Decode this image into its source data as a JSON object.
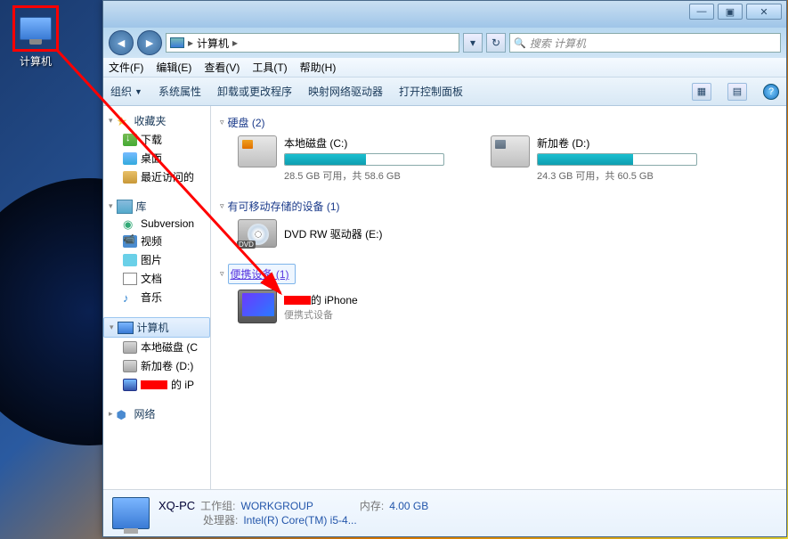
{
  "desktop": {
    "icon_label": "计算机"
  },
  "window": {
    "sys": {
      "min": "—",
      "max": "▣",
      "close": "✕"
    },
    "address": {
      "crumb1": "计算机",
      "refresh": "↻",
      "dropdown": "▾",
      "search_placeholder": "搜索 计算机"
    },
    "menu": {
      "file": "文件(F)",
      "edit": "编辑(E)",
      "view": "查看(V)",
      "tools": "工具(T)",
      "help": "帮助(H)"
    },
    "toolbar": {
      "organize": "组织",
      "properties": "系统属性",
      "uninstall": "卸载或更改程序",
      "map_drive": "映射网络驱动器",
      "control_panel": "打开控制面板",
      "view_icon": "▦",
      "preview_icon": "▤",
      "help": "?"
    }
  },
  "sidebar": {
    "favorites": {
      "label": "收藏夹",
      "items": [
        {
          "label": "下载",
          "icon": "dl"
        },
        {
          "label": "桌面",
          "icon": "desk"
        },
        {
          "label": "最近访问的",
          "icon": "recent"
        }
      ]
    },
    "libraries": {
      "label": "库",
      "items": [
        {
          "label": "Subversion",
          "icon": "svn"
        },
        {
          "label": "视频",
          "icon": "vid"
        },
        {
          "label": "图片",
          "icon": "pic"
        },
        {
          "label": "文档",
          "icon": "doc"
        },
        {
          "label": "音乐",
          "icon": "mus"
        }
      ]
    },
    "computer": {
      "label": "计算机",
      "items": [
        {
          "label": "本地磁盘 (C",
          "icon": "hdd"
        },
        {
          "label": "新加卷 (D:)",
          "icon": "hdd"
        },
        {
          "label_suffix": "的 iP",
          "icon": "iph",
          "redacted": true
        }
      ]
    },
    "network": {
      "label": "网络"
    }
  },
  "main": {
    "groups": {
      "hdd": {
        "label": "硬盘 (2)",
        "drives": [
          {
            "name": "本地磁盘 (C:)",
            "free": "28.5 GB 可用，共 58.6 GB",
            "fill_pct": 51
          },
          {
            "name": "新加卷 (D:)",
            "free": "24.3 GB 可用，共 60.5 GB",
            "fill_pct": 60
          }
        ]
      },
      "removable": {
        "label": "有可移动存储的设备 (1)",
        "items": [
          {
            "name": "DVD RW 驱动器 (E:)"
          }
        ]
      },
      "portable": {
        "label": "便携设备 (1)",
        "items": [
          {
            "name_suffix": "的 iPhone",
            "sub": "便携式设备",
            "redacted": true
          }
        ]
      }
    }
  },
  "details": {
    "name": "XQ-PC",
    "workgroup_label": "工作组:",
    "workgroup": "WORKGROUP",
    "memory_label": "内存:",
    "memory": "4.00 GB",
    "cpu_label": "处理器:",
    "cpu": "Intel(R) Core(TM) i5-4..."
  }
}
